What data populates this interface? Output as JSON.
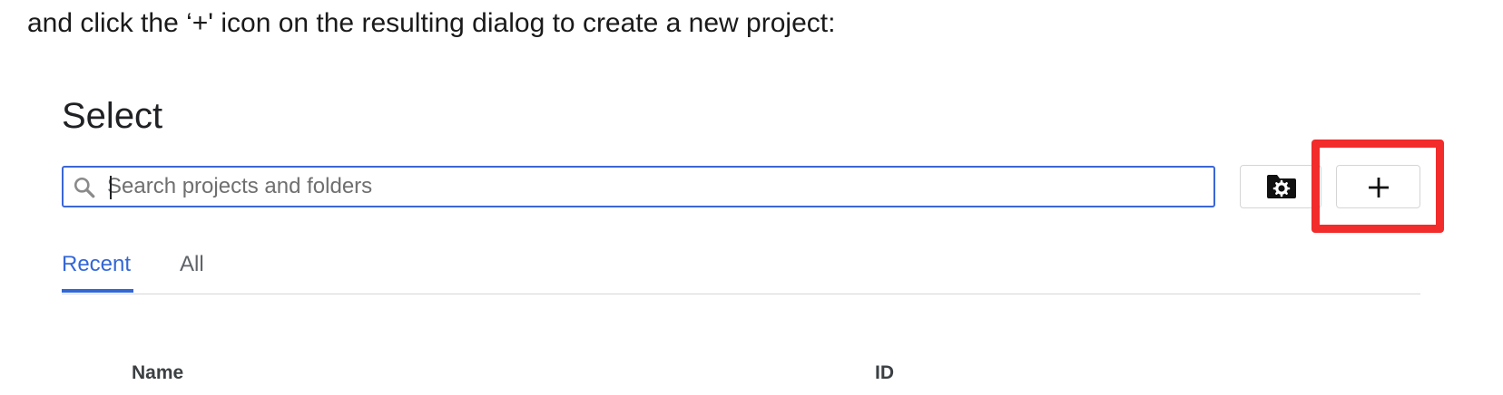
{
  "instruction": {
    "text": "and click the ‘+' icon on the resulting dialog to create a new project:"
  },
  "dialog": {
    "title": "Select",
    "search": {
      "placeholder": "Search projects and folders",
      "value": ""
    },
    "buttons": {
      "folder_icon": "folder-settings-icon",
      "new_project_icon": "plus-icon"
    },
    "tabs": [
      {
        "label": "Recent",
        "active": true
      },
      {
        "label": "All",
        "active": false
      }
    ],
    "table": {
      "columns": [
        "Name",
        "ID"
      ]
    }
  },
  "colors": {
    "accent": "#3367d6",
    "highlight": "#f22b2b",
    "search_border": "#3b67d6"
  }
}
